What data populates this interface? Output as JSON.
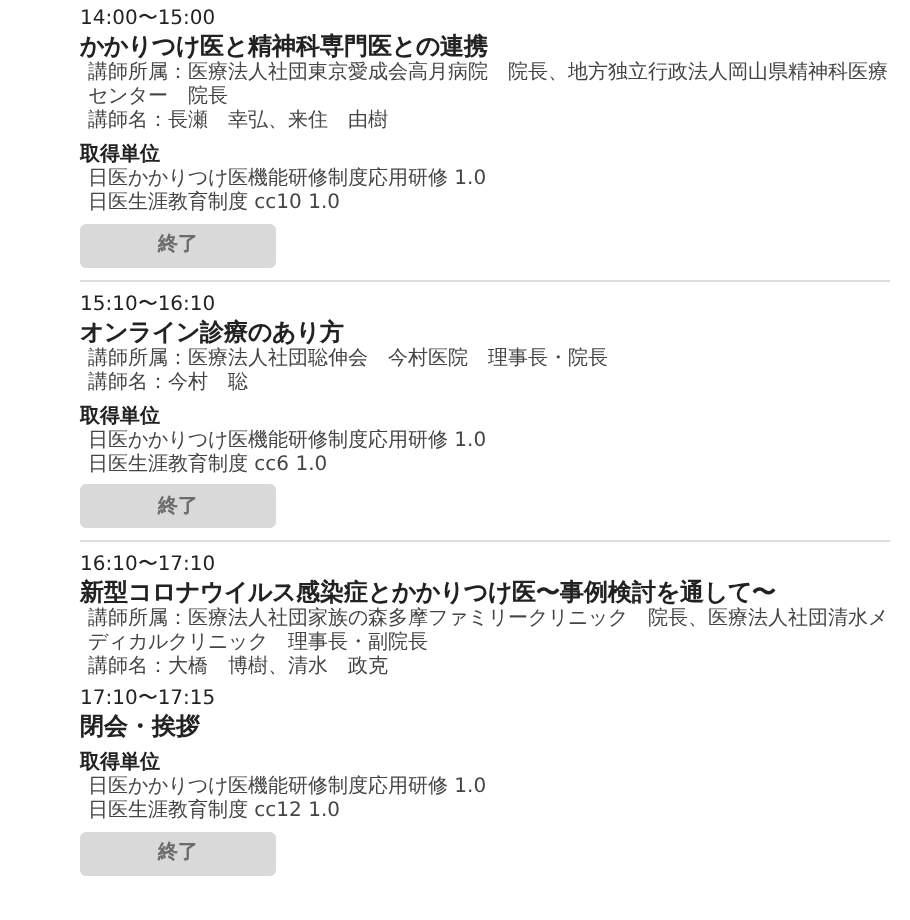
{
  "sessions": [
    {
      "time": "14:00〜15:00",
      "title": "かかりつけ医と精神科専門医との連携",
      "affiliation": "講師所属：医療法人社団東京愛成会高月病院　院長、地方独立行政法人岡山県精神科医療センター　院長",
      "lecturers": "講師名：長瀬　幸弘、来住　由樹",
      "credits_heading": "取得単位",
      "credits": [
        "日医かかりつけ医機能研修制度応用研修 1.0",
        "日医生涯教育制度 cc10 1.0"
      ],
      "button": {
        "label": "終了",
        "disabled": true
      },
      "divider": true
    },
    {
      "time": "15:10〜16:10",
      "title": "オンライン診療のあり方",
      "affiliation": "講師所属：医療法人社団聡伸会　今村医院　理事長・院長",
      "lecturers": "講師名：今村　聡",
      "credits_heading": "取得単位",
      "credits": [
        "日医かかりつけ医機能研修制度応用研修 1.0",
        "日医生涯教育制度 cc6 1.0"
      ],
      "button": {
        "label": "終了",
        "disabled": true
      },
      "divider": true
    },
    {
      "time": "16:10〜17:10",
      "title": "新型コロナウイルス感染症とかかりつけ医〜事例検討を通して〜",
      "affiliation": "講師所属：医療法人社団家族の森多摩ファミリークリニック　院長、医療法人社団清水メディカルクリニック　理事長・副院長",
      "lecturers": "講師名：大橋　博樹、清水　政克",
      "divider": false
    },
    {
      "time": "17:10〜17:15",
      "title": "閉会・挨拶",
      "credits_heading": "取得単位",
      "credits": [
        "日医かかりつけ医機能研修制度応用研修 1.0",
        "日医生涯教育制度 cc12 1.0"
      ],
      "button": {
        "label": "終了",
        "disabled": true
      },
      "divider": false
    }
  ]
}
